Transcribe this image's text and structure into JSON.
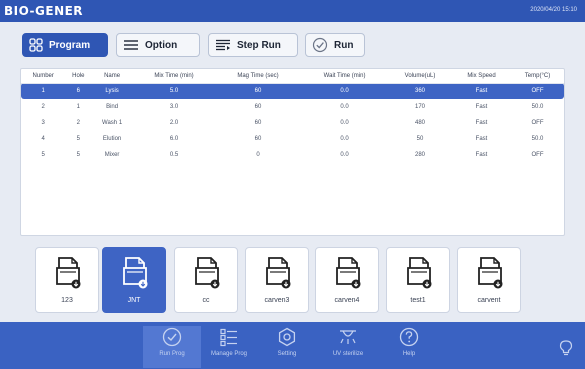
{
  "app": {
    "brand": "BIO-GENER",
    "clock": "2020/04/20 15:10"
  },
  "toolbar": {
    "program_label": "Program",
    "option_label": "Option",
    "steprun_label": "Step Run",
    "run_label": "Run"
  },
  "table": {
    "headers": [
      "Number",
      "Hole",
      "Name",
      "Mix Time (min)",
      "Mag Time (sec)",
      "Wait Time (min)",
      "Volume(uL)",
      "Mix Speed",
      "Temp(°C)"
    ],
    "rows": [
      [
        "1",
        "6",
        "Lysis",
        "5.0",
        "60",
        "0.0",
        "360",
        "Fast",
        "OFF"
      ],
      [
        "2",
        "1",
        "Bind",
        "3.0",
        "60",
        "0.0",
        "170",
        "Fast",
        "50.0"
      ],
      [
        "3",
        "2",
        "Wash 1",
        "2.0",
        "60",
        "0.0",
        "480",
        "Fast",
        "OFF"
      ],
      [
        "4",
        "5",
        "Elution",
        "6.0",
        "60",
        "0.0",
        "50",
        "Fast",
        "50.0"
      ],
      [
        "5",
        "5",
        "Mixer",
        "0.5",
        "0",
        "0.0",
        "280",
        "Fast",
        "OFF"
      ]
    ],
    "selected_row": 0
  },
  "files": [
    "123",
    "JNT",
    "cc",
    "carven3",
    "carven4",
    "test1",
    "carvent"
  ],
  "files_active": 1,
  "nav": {
    "items": [
      {
        "label": "Run Prog",
        "icon": "clock-check-icon"
      },
      {
        "label": "Manage Prog",
        "icon": "list-icon"
      },
      {
        "label": "Setting",
        "icon": "gear-icon"
      },
      {
        "label": "UV sterilize",
        "icon": "uv-lamp-icon"
      },
      {
        "label": "Help",
        "icon": "help-icon"
      }
    ],
    "active": 0
  },
  "colors": {
    "primary": "#2f56b4",
    "selected_row": "#3e64c4",
    "nav_bg": "#3a62c2"
  }
}
